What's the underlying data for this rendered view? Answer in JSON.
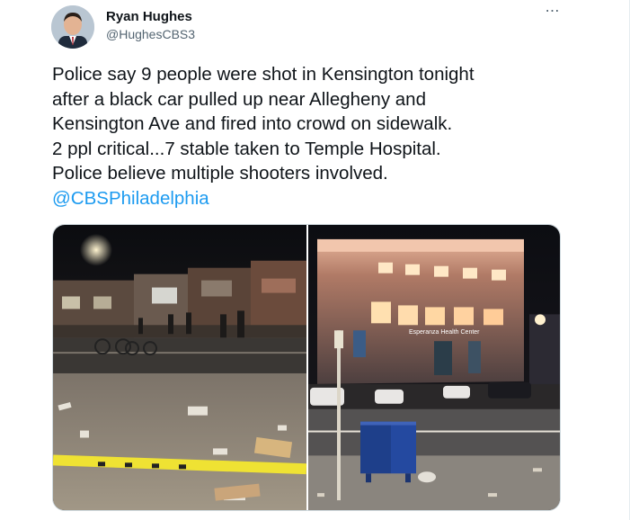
{
  "author": {
    "name": "Ryan Hughes",
    "handle": "@HughesCBS3"
  },
  "more_icon": "⋯",
  "tweet": {
    "text": "Police say 9 people were shot in Kensington tonight\nafter a black car pulled up near Allegheny and\nKensington Ave and fired into crowd on sidewalk.\n2 ppl critical...7 stable taken to Temple Hospital.\nPolice believe multiple shooters involved.",
    "mention": "@CBSPhiladelphia"
  },
  "media": {
    "right_photo_sign": "Esperanza Health Center"
  },
  "colors": {
    "link": "#1d9bf0",
    "secondary_text": "#536471",
    "crime_tape": "#f2e600"
  }
}
